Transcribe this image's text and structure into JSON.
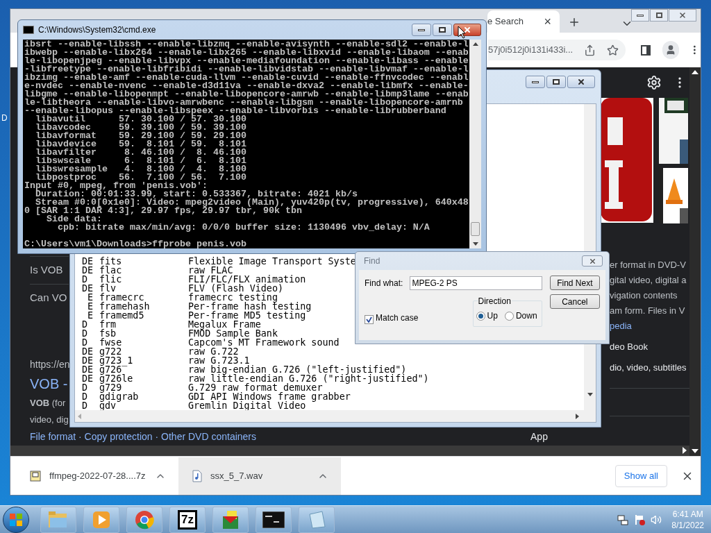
{
  "desktop": {
    "edge_text": "D"
  },
  "browser": {
    "tab": {
      "title": "e Search",
      "close": "×"
    },
    "address": "57j0i512j0i131i433i...",
    "left_texts": [
      {
        "kind": "question",
        "text": "Is VOB"
      },
      {
        "kind": "question",
        "text": "Can VO"
      },
      {
        "kind": "url",
        "text": "https://en"
      },
      {
        "kind": "heading",
        "text": "VOB -"
      },
      {
        "kind": "snippet",
        "text": "**VOB** (for"
      },
      {
        "kind": "snippet",
        "text": "video, dig"
      }
    ],
    "links_line": "File format · Copy protection · Other DVD containers",
    "bottom_fragment": "App",
    "right_texts": [
      {
        "kind": "snippet",
        "text": "er format in DVD-V"
      },
      {
        "kind": "snippet",
        "text": "gital video, digital a"
      },
      {
        "kind": "snippet",
        "text": "vigation contents"
      },
      {
        "kind": "snippet",
        "text": "am form. Files in V"
      },
      {
        "kind": "link",
        "text": "pedia"
      },
      {
        "kind": "item",
        "text": "deo Book"
      },
      {
        "kind": "item",
        "text": "dio, video, subtitles"
      }
    ]
  },
  "notepad": {
    "rows": [
      {
        "flags": "DE",
        "name": "fits",
        "description": "Flexible Image Transport Syste"
      },
      {
        "flags": "DE",
        "name": "flac",
        "description": "raw FLAC"
      },
      {
        "flags": "D",
        "name": "flic",
        "description": "FLI/FLC/FLX animation"
      },
      {
        "flags": "DE",
        "name": "flv",
        "description": "FLV (Flash Video)"
      },
      {
        "flags": " E",
        "name": "framecrc",
        "description": "framecrc testing"
      },
      {
        "flags": " E",
        "name": "framehash",
        "description": "Per-frame hash testing"
      },
      {
        "flags": " E",
        "name": "framemd5",
        "description": "Per-frame MD5 testing"
      },
      {
        "flags": "D",
        "name": "frm",
        "description": "Megalux Frame"
      },
      {
        "flags": "D",
        "name": "fsb",
        "description": "FMOD Sample Bank"
      },
      {
        "flags": "D",
        "name": "fwse",
        "description": "Capcom's MT Framework sound"
      },
      {
        "flags": "DE",
        "name": "g722",
        "description": "raw G.722"
      },
      {
        "flags": "DE",
        "name": "g723_1",
        "description": "raw G.723.1"
      },
      {
        "flags": "DE",
        "name": "g726",
        "description": "raw big-endian G.726 (\"left-justified\")"
      },
      {
        "flags": "DE",
        "name": "g726le",
        "description": "raw little-endian G.726 (\"right-justified\")"
      },
      {
        "flags": "D",
        "name": "g729",
        "description": "G.729 raw format demuxer"
      },
      {
        "flags": "D",
        "name": "gdigrab",
        "description": "GDI API Windows frame grabber"
      },
      {
        "flags": "D",
        "name": "gdv",
        "description": "Gremlin Digital Video"
      }
    ]
  },
  "console": {
    "title": "C:\\Windows\\System32\\cmd.exe",
    "lines": [
      "ibsrt --enable-libssh --enable-libzmq --enable-avisynth --enable-sdl2 --enable-l",
      "ibwebp --enable-libx264 --enable-libx265 --enable-libxvid --enable-libaom --enab",
      "le-libopenjpeg --enable-libvpx --enable-mediafoundation --enable-libass --enable",
      "-libfreetype --enable-libfribidi --enable-libvidstab --enable-libvmaf --enable-l",
      "ibzimg --enable-amf --enable-cuda-llvm --enable-cuvid --enable-ffnvcodec --enabl",
      "e-nvdec --enable-nvenc --enable-d3d11va --enable-dxva2 --enable-libmfx --enable-",
      "libgme --enable-libopenmpt --enable-libopencore-amrwb --enable-libmp3lame --enab",
      "le-libtheora --enable-libvo-amrwbenc --enable-libgsm --enable-libopencore-amrnb",
      "--enable-libopus --enable-libspeex --enable-libvorbis --enable-librubberband",
      "  libavutil      57. 30.100 / 57. 30.100",
      "  libavcodec     59. 39.100 / 59. 39.100",
      "  libavformat    59. 29.100 / 59. 29.100",
      "  libavdevice    59.  8.101 / 59.  8.101",
      "  libavfilter     8. 46.100 /  8. 46.100",
      "  libswscale      6.  8.101 /  6.  8.101",
      "  libswresample   4.  8.100 /  4.  8.100",
      "  libpostproc    56.  7.100 / 56.  7.100",
      "Input #0, mpeg, from 'penis.vob':",
      "  Duration: 00:01:33.99, start: 0.533367, bitrate: 4021 kb/s",
      "  Stream #0:0[0x1e0]: Video: mpeg2video (Main), yuv420p(tv, progressive), 640x48",
      "0 [SAR 1:1 DAR 4:3], 29.97 fps, 29.97 tbr, 90k tbn",
      "    Side data:",
      "      cpb: bitrate max/min/avg: 0/0/0 buffer size: 1130496 vbv_delay: N/A"
    ],
    "prompt": "C:\\Users\\vm1\\Downloads>ffprobe penis.vob"
  },
  "find": {
    "title": "Find",
    "label": "Find what:",
    "value": "MPEG-2 PS",
    "find_next": "Find Next",
    "cancel": "Cancel",
    "direction": {
      "label": "Direction",
      "options": [
        {
          "label": "Up",
          "selected": true
        },
        {
          "label": "Down",
          "selected": false
        }
      ]
    },
    "match_case": {
      "label": "Match case",
      "checked": true
    }
  },
  "downloads": {
    "items": [
      {
        "name": "ffmpeg-2022-07-28....7z",
        "kind": "archive",
        "highlighted": false
      },
      {
        "name": "ssx_5_7.wav",
        "kind": "audio",
        "highlighted": true
      }
    ],
    "show_all": "Show all"
  },
  "taskbar": {
    "apps": [
      {
        "kind": "explorer"
      },
      {
        "kind": "media"
      },
      {
        "kind": "chrome"
      },
      {
        "kind": "sevenzip",
        "label": "7z"
      },
      {
        "kind": "installer"
      },
      {
        "kind": "console"
      },
      {
        "kind": "notepad"
      }
    ],
    "time": "6:41 AM",
    "date": "8/1/2022"
  }
}
